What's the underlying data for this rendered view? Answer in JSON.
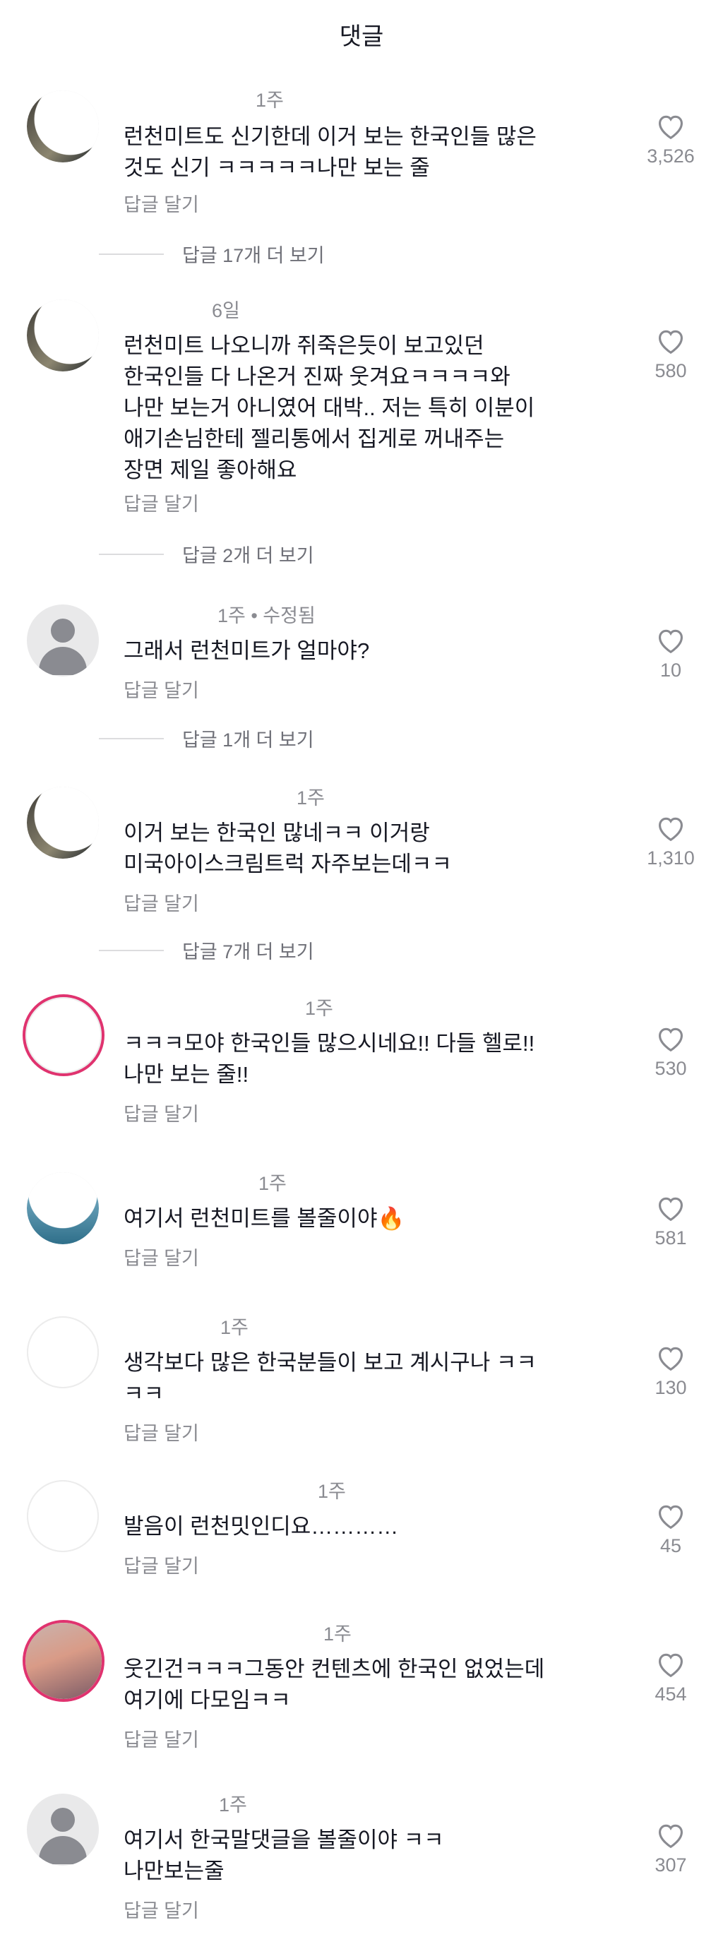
{
  "header": {
    "title": "댓글"
  },
  "labels": {
    "reply": "답글 달기"
  },
  "comments": [
    {
      "username": "",
      "time": "1주",
      "text": "런천미트도 신기한데 이거 보는 한국인들 많은\n것도 신기 ㅋㅋㅋㅋㅋ나만 보는 줄",
      "likes": "3,526",
      "more_replies": "답글 17개 더 보기",
      "avatar": "crescent"
    },
    {
      "username": "",
      "time": "6일",
      "text": "런천미트 나오니까 쥐죽은듯이 보고있던\n한국인들 다 나온거 진짜 웃겨요ㅋㅋㅋㅋ와\n나만 보는거 아니였어 대박.. 저는 특히 이분이\n애기손님한테 젤리통에서 집게로 꺼내주는\n장면 제일 좋아해요",
      "likes": "580",
      "more_replies": "답글 2개 더 보기",
      "avatar": "crescent"
    },
    {
      "username": "",
      "time": "1주 • 수정됨",
      "text": "그래서 런천미트가 얼마야?",
      "likes": "10",
      "more_replies": "답글 1개 더 보기",
      "avatar": "default"
    },
    {
      "username": "",
      "time": "1주",
      "text": "이거 보는 한국인 많네ㅋㅋ 이거랑\n미국아이스크림트럭 자주보는데ㅋㅋ",
      "likes": "1,310",
      "more_replies": "답글 7개 더 보기",
      "avatar": "crescent"
    },
    {
      "username": "",
      "time": "1주",
      "text": "ㅋㅋㅋ모야 한국인들 많으시네요!! 다들 헬로!!\n나만 보는 줄!!",
      "likes": "530",
      "more_replies": "",
      "avatar": "blank-ring"
    },
    {
      "username": "",
      "time": "1주",
      "text": "여기서 런천미트를 볼줄이야🔥",
      "likes": "581",
      "more_replies": "",
      "avatar": "sky"
    },
    {
      "username": "",
      "time": "1주",
      "text": "생각보다 많은 한국분들이 보고 계시구나 ㅋㅋ\nㅋㅋ",
      "likes": "130",
      "more_replies": "",
      "avatar": "blank"
    },
    {
      "username": "",
      "time": "1주",
      "text": "발음이 런천밋인디요…………",
      "likes": "45",
      "more_replies": "",
      "avatar": "blank"
    },
    {
      "username": "",
      "time": "1주",
      "text": "웃긴건ㅋㅋㅋ그동안 컨텐츠에 한국인 없었는데\n여기에 다모임ㅋㅋ",
      "likes": "454",
      "more_replies": "",
      "avatar": "sunset-ring"
    },
    {
      "username": "",
      "time": "1주",
      "text": "여기서 한국말댓글을 볼줄이야 ㅋㅋ\n나만보는줄",
      "likes": "307",
      "more_replies": "",
      "avatar": "default"
    }
  ],
  "colors": {
    "text": "#161823",
    "secondary": "#8a8b91",
    "ring": "#e0336f"
  }
}
